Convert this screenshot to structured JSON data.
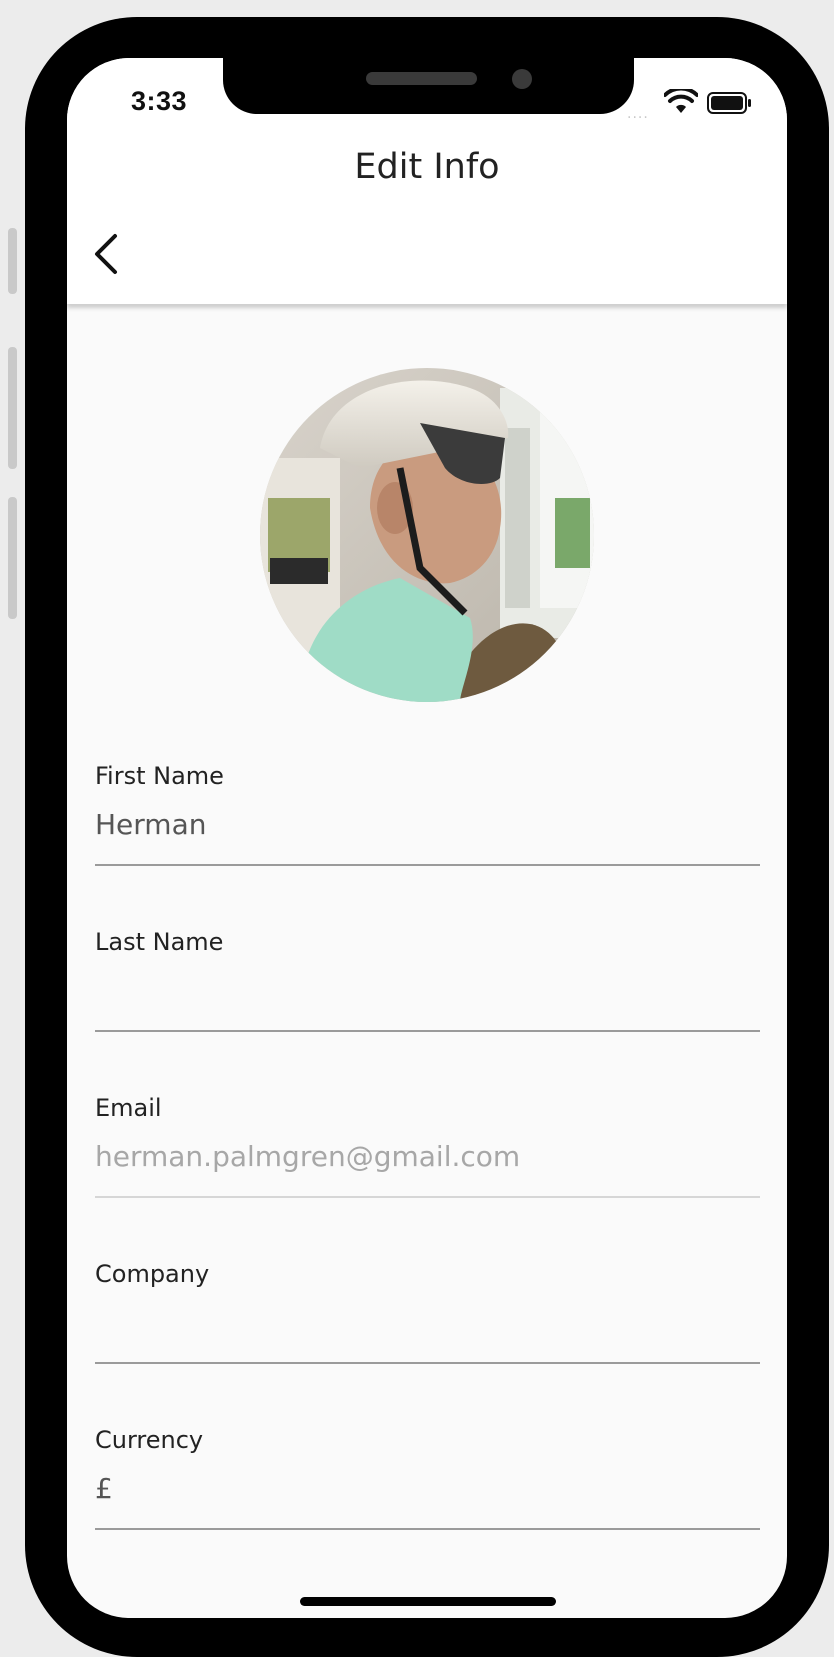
{
  "status_bar": {
    "time": "3:33",
    "signal": "....",
    "wifi_icon": "wifi-icon",
    "battery_icon": "battery-icon"
  },
  "header": {
    "title": "Edit Info",
    "back_icon": "chevron-left-icon"
  },
  "profile": {
    "avatar": "profile-photo"
  },
  "form": {
    "first_name": {
      "label": "First Name",
      "value": "Herman"
    },
    "last_name": {
      "label": "Last Name",
      "value": ""
    },
    "email": {
      "label": "Email",
      "value": "herman.palmgren@gmail.com"
    },
    "company": {
      "label": "Company",
      "value": ""
    },
    "currency": {
      "label": "Currency",
      "value": "£"
    }
  },
  "colors": {
    "frame": "#000000",
    "screen_bg": "#fafafa",
    "text_primary": "#222222",
    "text_muted": "#a7a7a7",
    "divider": "#9a9a9a"
  }
}
